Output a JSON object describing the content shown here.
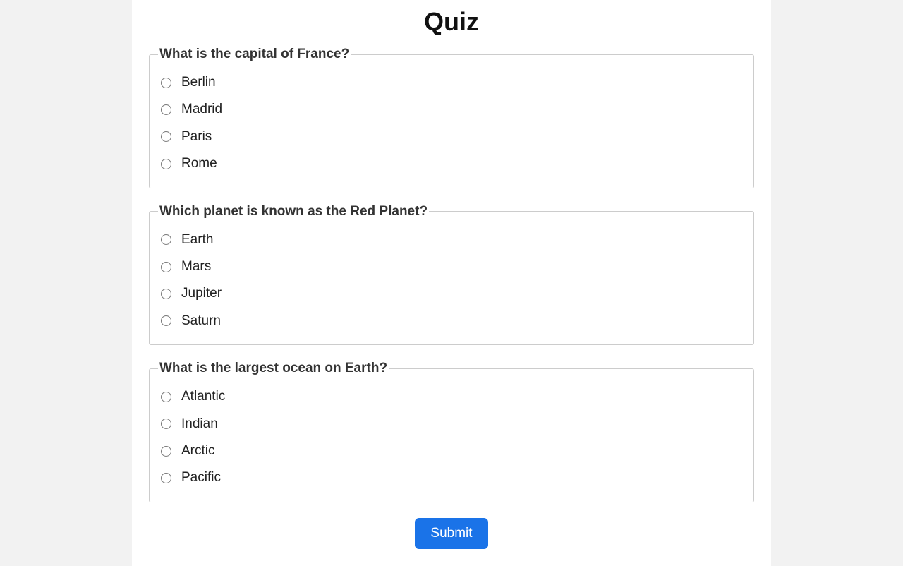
{
  "title": "Quiz",
  "questions": [
    {
      "legend": "What is the capital of France?",
      "options": [
        "Berlin",
        "Madrid",
        "Paris",
        "Rome"
      ]
    },
    {
      "legend": "Which planet is known as the Red Planet?",
      "options": [
        "Earth",
        "Mars",
        "Jupiter",
        "Saturn"
      ]
    },
    {
      "legend": "What is the largest ocean on Earth?",
      "options": [
        "Atlantic",
        "Indian",
        "Arctic",
        "Pacific"
      ]
    }
  ],
  "submit_label": "Submit"
}
